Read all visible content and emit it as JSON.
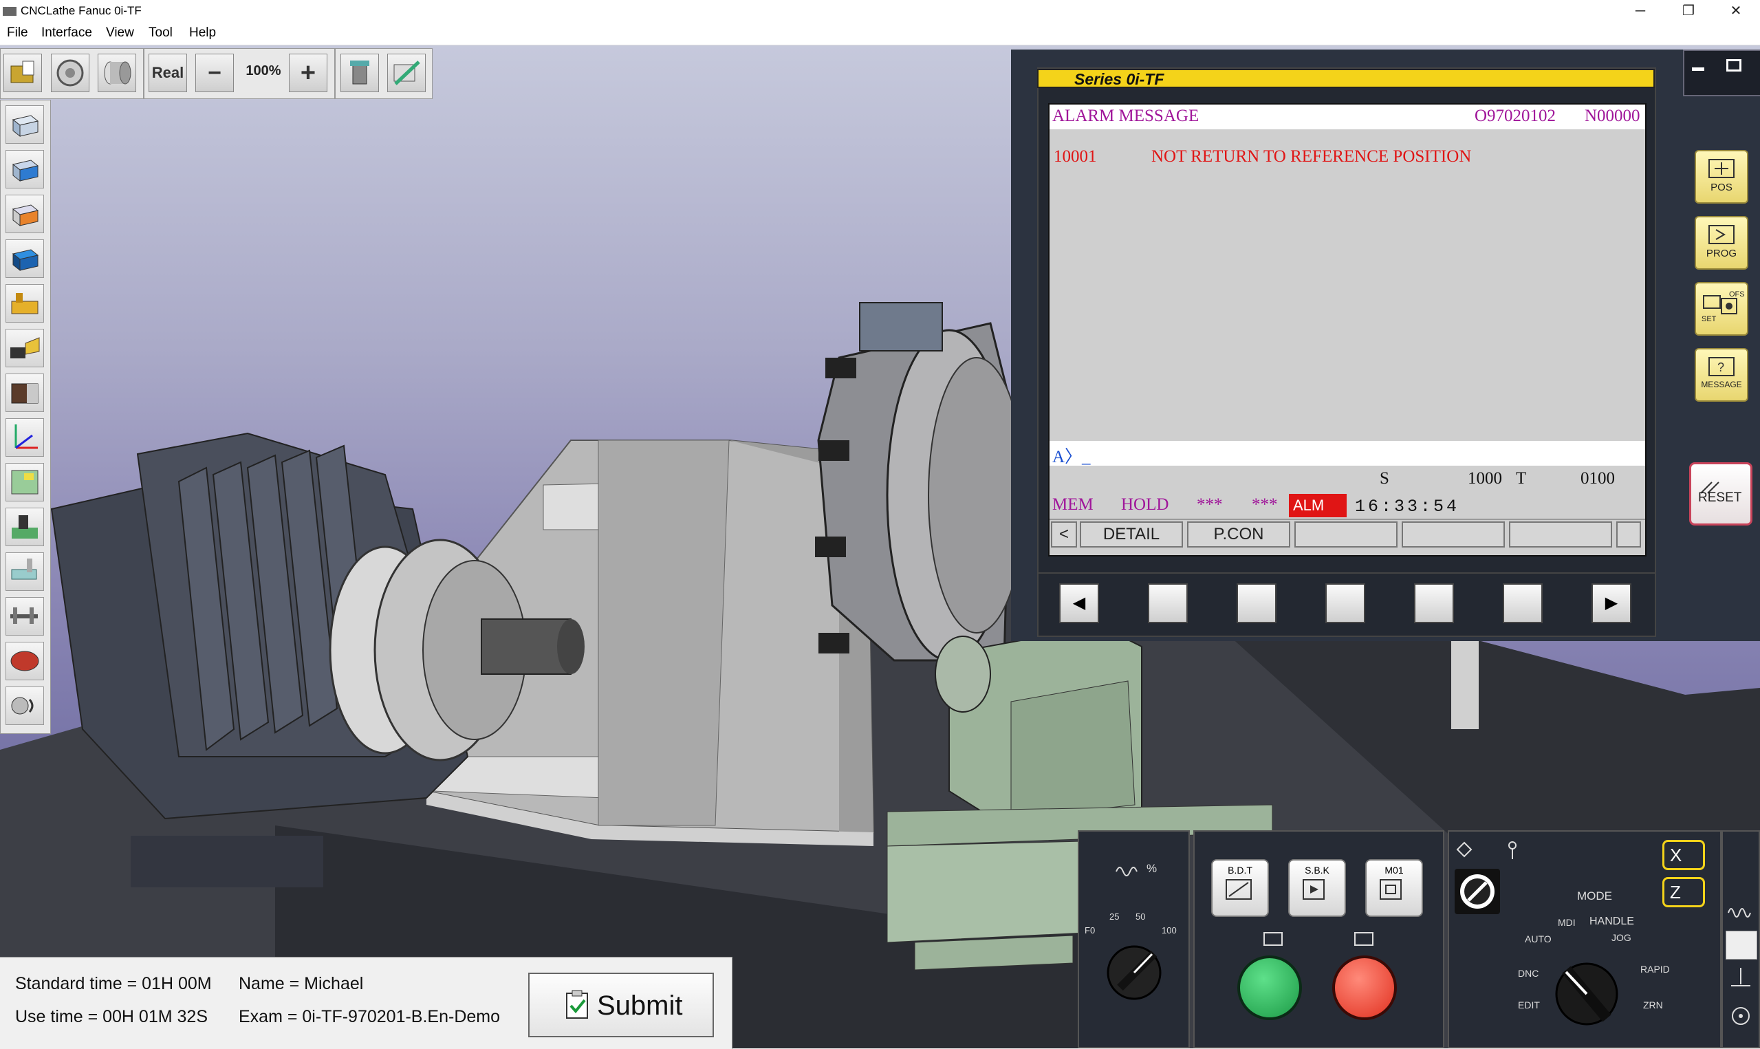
{
  "window": {
    "title": "CNCLathe Fanuc 0i-TF",
    "minimize": "─",
    "maximize": "❐",
    "close": "✕"
  },
  "menu": [
    "File",
    "Interface",
    "View",
    "Tool",
    "Help"
  ],
  "toolbar": {
    "speed_label": "Real",
    "zoom_minus": "−",
    "zoom_value": "100%",
    "zoom_plus": "+"
  },
  "cnc": {
    "series": "Series 0i-TF",
    "screen_title": "ALARM MESSAGE",
    "program_no": "O97020102",
    "sequence_no": "N00000",
    "alarm_code": "10001",
    "alarm_text": "NOT RETURN TO REFERENCE POSITION",
    "input_prompt": "A〉_",
    "spindle_label": "S",
    "spindle_value": "1000",
    "tool_label": "T",
    "tool_value": "0100",
    "status_mode": "MEM",
    "status_state": "HOLD",
    "status_stars1": "***",
    "status_stars2": "***",
    "status_alm": "ALM",
    "status_time": "16:33:54",
    "softkeys": [
      "<",
      "DETAIL",
      "P.CON",
      "",
      "",
      "",
      ""
    ],
    "nav_left": "◀",
    "nav_right": "▶",
    "function_keys": [
      "POS",
      "PROG",
      "SET",
      "OFS",
      "MESSAGE"
    ],
    "reset_label": "RESET"
  },
  "operator_panel": {
    "feed_label": "%",
    "feed_scale": [
      "F0",
      "25",
      "50",
      "100"
    ],
    "bdt_label": "B.D.T",
    "sbk_label": "S.B.K",
    "m01_label": "M01",
    "mode_label": "MODE",
    "mode_items": [
      "MDI",
      "HANDLE",
      "AUTO",
      "JOG",
      "DNC",
      "RAPID",
      "EDIT",
      "ZRN"
    ],
    "axis_x": "X",
    "axis_z": "Z"
  },
  "info": {
    "standard_time": "Standard time = 01H 00M",
    "use_time": "Use time = 00H 01M 32S",
    "name": "Name = Michael",
    "exam": "Exam = 0i-TF-970201-B.En-Demo",
    "submit_label": "Submit"
  },
  "colors": {
    "alarm_red": "#e01515",
    "magenta_text": "#a0169a",
    "yellow_header": "#f4d31a",
    "panel_bg": "#2c3340"
  }
}
